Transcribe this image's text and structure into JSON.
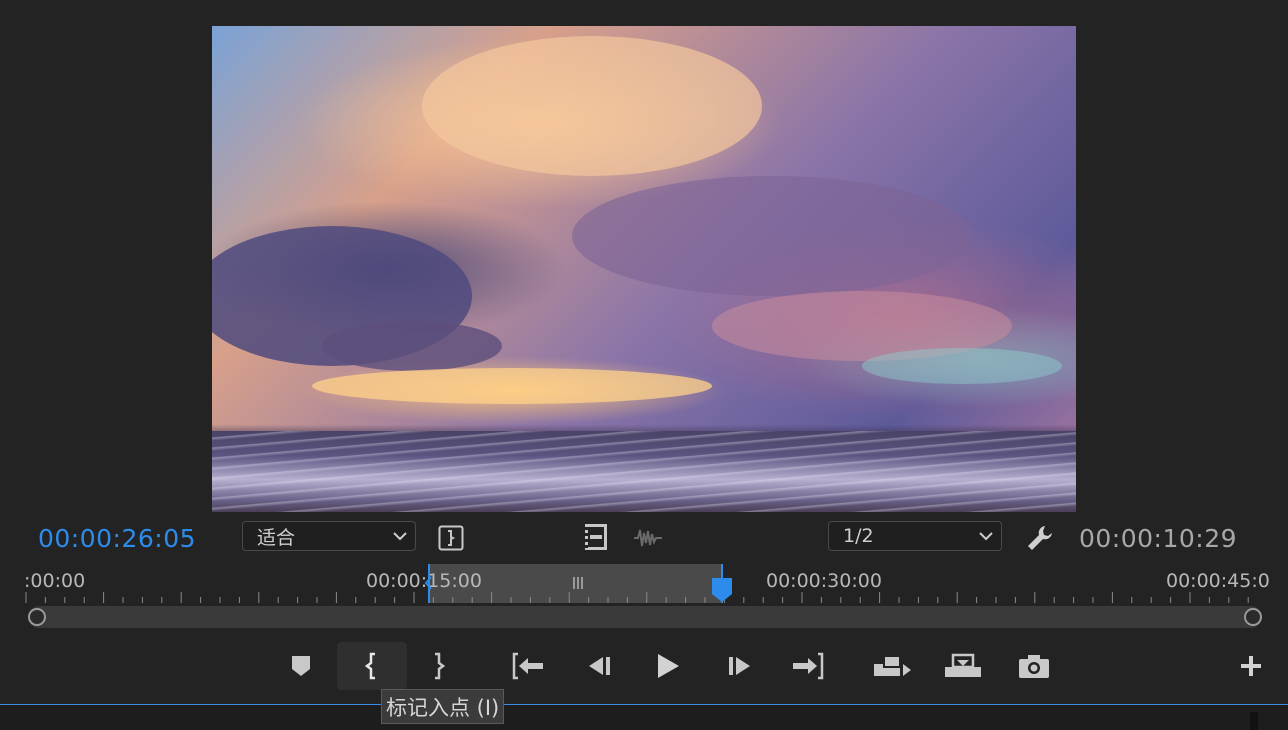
{
  "monitor": {
    "current_timecode": "00:00:26:05",
    "duration_timecode": "00:00:10:29",
    "zoom": "适合",
    "resolution": "1/2"
  },
  "ruler": {
    "labels": [
      ":00:00",
      "00:00:15:00",
      "00:00:30:00",
      "00:00:45:0"
    ]
  },
  "tooltip": {
    "text": "标记入点 (I)"
  },
  "icons": {
    "settings": "wrench-icon",
    "add": "plus-icon"
  },
  "colors": {
    "accent": "#2d8ceb",
    "background": "#232323"
  }
}
